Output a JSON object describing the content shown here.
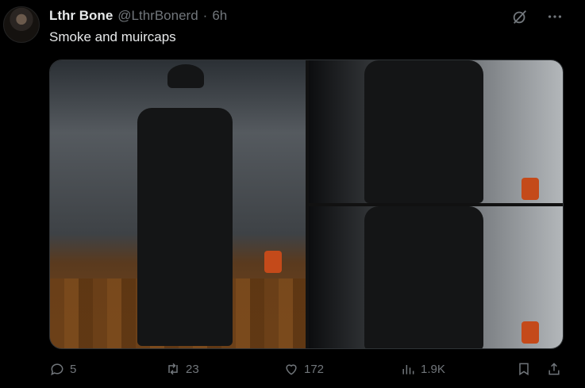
{
  "tweet": {
    "display_name": "Lthr Bone",
    "handle": "@LthrBonerd",
    "separator": "·",
    "time": "6h",
    "text": "Smoke and muircaps"
  },
  "header_icons": [
    "grok-icon",
    "more-icon"
  ],
  "actions": {
    "replies": "5",
    "retweets": "23",
    "likes": "172",
    "views": "1.9K"
  },
  "colors": {
    "background": "#000000",
    "text": "#e7e9ea",
    "muted": "#71767b",
    "border": "#2f3336"
  }
}
